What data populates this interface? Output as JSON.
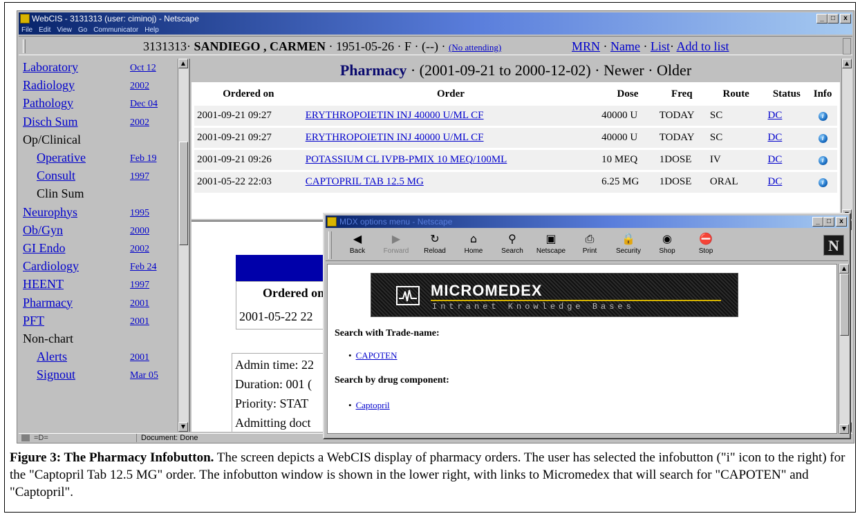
{
  "window": {
    "title": "WebCIS - 3131313 (user: ciminoj) - Netscape",
    "buttons": {
      "minimize": "_",
      "maximize": "□",
      "close": "x"
    }
  },
  "menubar": [
    "File",
    "Edit",
    "View",
    "Go",
    "Communicator",
    "Help"
  ],
  "patient_header": {
    "mrn": "3131313",
    "name": "SANDIEGO , CARMEN",
    "dob": "1951-05-26",
    "sex": "F",
    "extra": "(--)",
    "attending": "(No attending)",
    "sep": "·",
    "links": [
      "MRN",
      "Name",
      "List",
      "Add to list"
    ]
  },
  "nav": [
    {
      "label": "Laboratory",
      "date": "Oct 12",
      "link": true,
      "sub": false
    },
    {
      "label": "Radiology",
      "date": "2002",
      "link": true,
      "sub": false
    },
    {
      "label": "Pathology",
      "date": "Dec 04",
      "link": true,
      "sub": false
    },
    {
      "label": "Disch Sum",
      "date": "2002",
      "link": true,
      "sub": false
    },
    {
      "label": "Op/Clinical",
      "date": "",
      "link": false,
      "sub": false
    },
    {
      "label": "Operative",
      "date": "Feb 19",
      "link": true,
      "sub": true
    },
    {
      "label": "Consult",
      "date": "1997",
      "link": true,
      "sub": true
    },
    {
      "label": "Clin Sum",
      "date": "",
      "link": false,
      "sub": true
    },
    {
      "label": "Neurophys",
      "date": "1995",
      "link": true,
      "sub": false
    },
    {
      "label": "Ob/Gyn",
      "date": "2000",
      "link": true,
      "sub": false
    },
    {
      "label": "GI Endo",
      "date": "2002",
      "link": true,
      "sub": false
    },
    {
      "label": "Cardiology",
      "date": "Feb 24",
      "link": true,
      "sub": false
    },
    {
      "label": "HEENT",
      "date": "1997",
      "link": true,
      "sub": false
    },
    {
      "label": "Pharmacy",
      "date": "2001",
      "link": true,
      "sub": false
    },
    {
      "label": "PFT",
      "date": "2001",
      "link": true,
      "sub": false
    },
    {
      "label": "Non-chart",
      "date": "",
      "link": false,
      "sub": false
    },
    {
      "label": "Alerts",
      "date": "2001",
      "link": true,
      "sub": true
    },
    {
      "label": "Signout",
      "date": "Mar 05",
      "link": true,
      "sub": true
    }
  ],
  "pharmacy": {
    "title": "Pharmacy",
    "range": "· (2001-09-21 to 2000-12-02)",
    "newer": "· Newer",
    "older": "· Older",
    "columns": [
      "Ordered on",
      "Order",
      "Dose",
      "Freq",
      "Route",
      "Status",
      "Info"
    ],
    "rows": [
      {
        "ordered_on": "2001-09-21 09:27",
        "order": "ERYTHROPOIETIN INJ 40000 U/ML CF",
        "dose": "40000 U",
        "freq": "TODAY",
        "route": "SC",
        "status": "DC"
      },
      {
        "ordered_on": "2001-09-21 09:27",
        "order": "ERYTHROPOIETIN INJ 40000 U/ML CF",
        "dose": "40000 U",
        "freq": "TODAY",
        "route": "SC",
        "status": "DC"
      },
      {
        "ordered_on": "2001-09-21 09:26",
        "order": "POTASSIUM CL IVPB-PMIX 10 MEQ/100ML",
        "dose": "10 MEQ",
        "freq": "1DOSE",
        "route": "IV",
        "status": "DC"
      },
      {
        "ordered_on": "2001-05-22 22:03",
        "order": "CAPTOPRIL TAB 12.5 MG",
        "dose": "6.25 MG",
        "freq": "1DOSE",
        "route": "ORAL",
        "status": "DC"
      }
    ],
    "info_glyph": "i"
  },
  "detail": {
    "ordered_heading": "Ordered on",
    "ordered_value": "2001-05-22 22",
    "lines": [
      "Admin time: 22",
      "Duration: 001 (",
      "Priority: STAT",
      "Admitting doct"
    ]
  },
  "statusbar": {
    "connection": "=D=",
    "message": "Document: Done"
  },
  "popup": {
    "title": "MDX options menu - Netscape",
    "toolbar": [
      {
        "label": "Back",
        "icon": "back-arrow-icon",
        "glyph": "◀",
        "disabled": false
      },
      {
        "label": "Forward",
        "icon": "forward-arrow-icon",
        "glyph": "▶",
        "disabled": true
      },
      {
        "label": "Reload",
        "icon": "reload-icon",
        "glyph": "↻",
        "disabled": false
      },
      {
        "label": "Home",
        "icon": "home-icon",
        "glyph": "⌂",
        "disabled": false
      },
      {
        "label": "Search",
        "icon": "search-icon",
        "glyph": "⚲",
        "disabled": false
      },
      {
        "label": "Netscape",
        "icon": "netscape-icon",
        "glyph": "▣",
        "disabled": false
      },
      {
        "label": "Print",
        "icon": "print-icon",
        "glyph": "⎙",
        "disabled": false
      },
      {
        "label": "Security",
        "icon": "security-lock-icon",
        "glyph": "🔒",
        "disabled": false
      },
      {
        "label": "Shop",
        "icon": "shop-icon",
        "glyph": "◉",
        "disabled": false
      },
      {
        "label": "Stop",
        "icon": "stop-icon",
        "glyph": "⛔",
        "disabled": false
      }
    ],
    "netscape_logo": "N",
    "banner": {
      "title": "MICROMEDEX",
      "subtitle": "Intranet Knowledge Bases"
    },
    "sections": [
      {
        "heading": "Search with Trade-name:",
        "links": [
          "CAPOTEN"
        ]
      },
      {
        "heading": "Search by drug component:",
        "links": [
          "Captopril"
        ]
      }
    ]
  },
  "caption": {
    "bold": "Figure 3: The Pharmacy Infobutton.",
    "text": " The screen depicts a WebCIS display of pharmacy orders.  The user has selected the infobutton  (\"i\" icon to the right) for the \"Captopril Tab 12.5 MG\" order.  The infobutton window is shown in the lower right, with links to Micromedex that will search for \"CAPOTEN\" and \"Captopril\"."
  },
  "colors": {
    "title_gradient_start": "#08246b",
    "link": "#0000cc",
    "chrome": "#c0c0c0",
    "banner_accent": "#d4b200"
  }
}
